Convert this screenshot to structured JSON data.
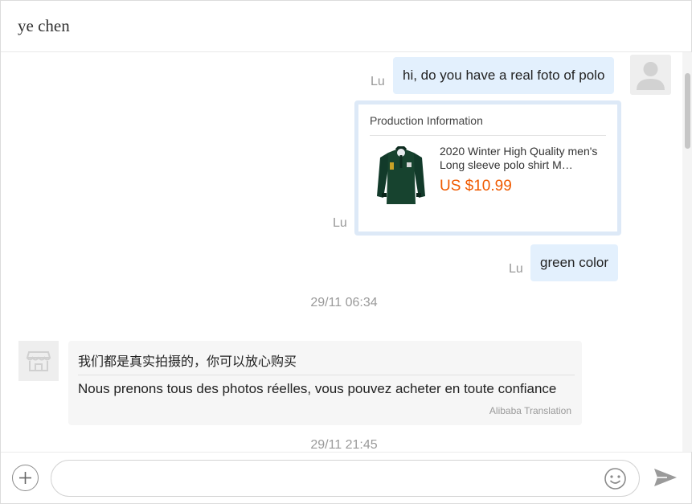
{
  "header": {
    "contact_name": "ye chen"
  },
  "conversation": {
    "outgoing_1": {
      "sender": "Lu",
      "text": "hi, do you have a real foto of polo"
    },
    "product_card": {
      "sender": "Lu",
      "title": "Production Information",
      "product_name": "2020 Winter High Quality men's Long sleeve polo shirt M…",
      "price": "US $10.99"
    },
    "outgoing_2": {
      "sender": "Lu",
      "text": "green color"
    },
    "timestamp_1": "29/11 06:34",
    "incoming_1": {
      "original": "我们都是真实拍摄的，你可以放心购买",
      "translated": "Nous prenons tous des photos réelles, vous pouvez acheter en toute confiance",
      "translation_credit": "Alibaba Translation"
    },
    "timestamp_2": "29/11 21:45"
  },
  "composer": {
    "value": "",
    "placeholder": ""
  },
  "icons": {
    "add": "plus-circle-icon",
    "emoji": "smiley-icon",
    "send": "paper-plane-icon",
    "user_avatar": "default-user-icon",
    "shop_avatar": "storefront-icon"
  },
  "colors": {
    "outgoing_bubble": "#e3f0fd",
    "card_border": "#dde9f7",
    "price": "#f05a00",
    "incoming_bubble": "#f6f6f6"
  }
}
